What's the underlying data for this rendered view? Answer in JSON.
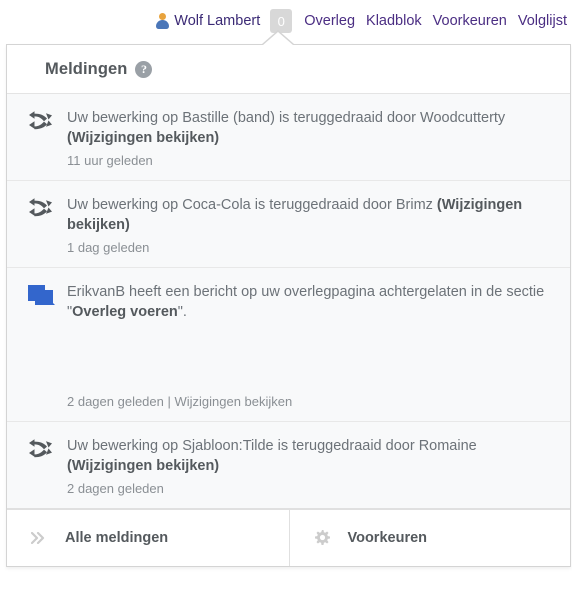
{
  "topbar": {
    "user_icon": "user-avatar-icon",
    "username": "Wolf Lambert",
    "notification_badge": "0",
    "links": [
      {
        "label": "Overleg"
      },
      {
        "label": "Kladblok"
      },
      {
        "label": "Voorkeuren"
      },
      {
        "label": "Volglijst"
      }
    ]
  },
  "panel": {
    "title": "Meldingen",
    "help_icon": "question-mark-icon",
    "notifications": [
      {
        "icon": "revert-icon",
        "text_before": "Uw bewerking op Bastille (band) is teruggedraaid door Woodcutterty ",
        "text_bold": "(Wijzigingen bekijken)",
        "text_after": "",
        "time": "11 uur geleden",
        "footer": ""
      },
      {
        "icon": "revert-icon",
        "text_before": "Uw bewerking op Coca-Cola is teruggedraaid door Brimz ",
        "text_bold": "(Wijzigingen bekijken)",
        "text_after": "",
        "time": "1 dag geleden",
        "footer": ""
      },
      {
        "icon": "talk-page-icon",
        "text_before": "ErikvanB heeft een bericht op uw overlegpagina achtergelaten in de sectie \"",
        "text_bold": "Overleg voeren",
        "text_after": "\".",
        "time": "",
        "footer": "2 dagen geleden | Wijzigingen bekijken"
      },
      {
        "icon": "revert-icon",
        "text_before": "Uw bewerking op Sjabloon:Tilde is teruggedraaid door Romaine ",
        "text_bold": "(Wijzigingen bekijken)",
        "text_after": "",
        "time": "2 dagen geleden",
        "footer": ""
      }
    ],
    "footer_buttons": [
      {
        "icon": "double-chevron-right-icon",
        "label": "Alle meldingen"
      },
      {
        "icon": "gear-icon",
        "label": "Voorkeuren"
      }
    ]
  },
  "colors": {
    "link": "#4b2e83",
    "panel_bg": "#f8f9fa",
    "badge_bg": "#d8d8d8",
    "talk_icon": "#36c",
    "text": "#54595d"
  }
}
